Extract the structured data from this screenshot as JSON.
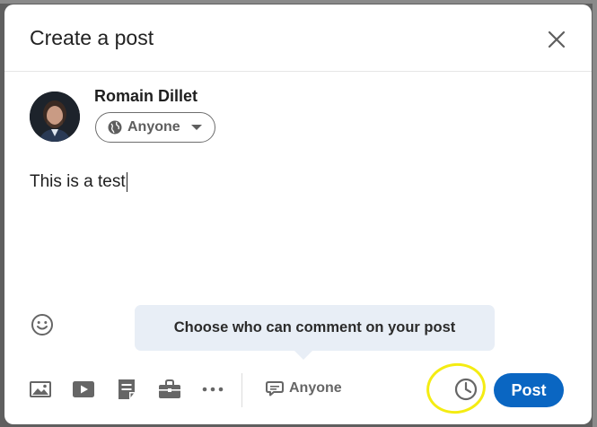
{
  "dialog": {
    "title": "Create a post",
    "close_icon": "close-icon"
  },
  "author": {
    "name": "Romain Dillet",
    "audience": "Anyone",
    "audience_icon": "globe-icon"
  },
  "editor": {
    "text": "This is a test"
  },
  "tooltip": {
    "text": "Choose who can comment on your post"
  },
  "toolbar": {
    "icons": [
      "photo-icon",
      "video-icon",
      "document-icon",
      "briefcase-icon",
      "more-icon"
    ],
    "comment_setting_label": "Anyone",
    "comment_icon": "comment-icon",
    "schedule_icon": "clock-icon",
    "post_label": "Post"
  },
  "colors": {
    "primary": "#0a66c2",
    "tooltip_bg": "#e8eef6",
    "highlight": "#f4ec12"
  }
}
